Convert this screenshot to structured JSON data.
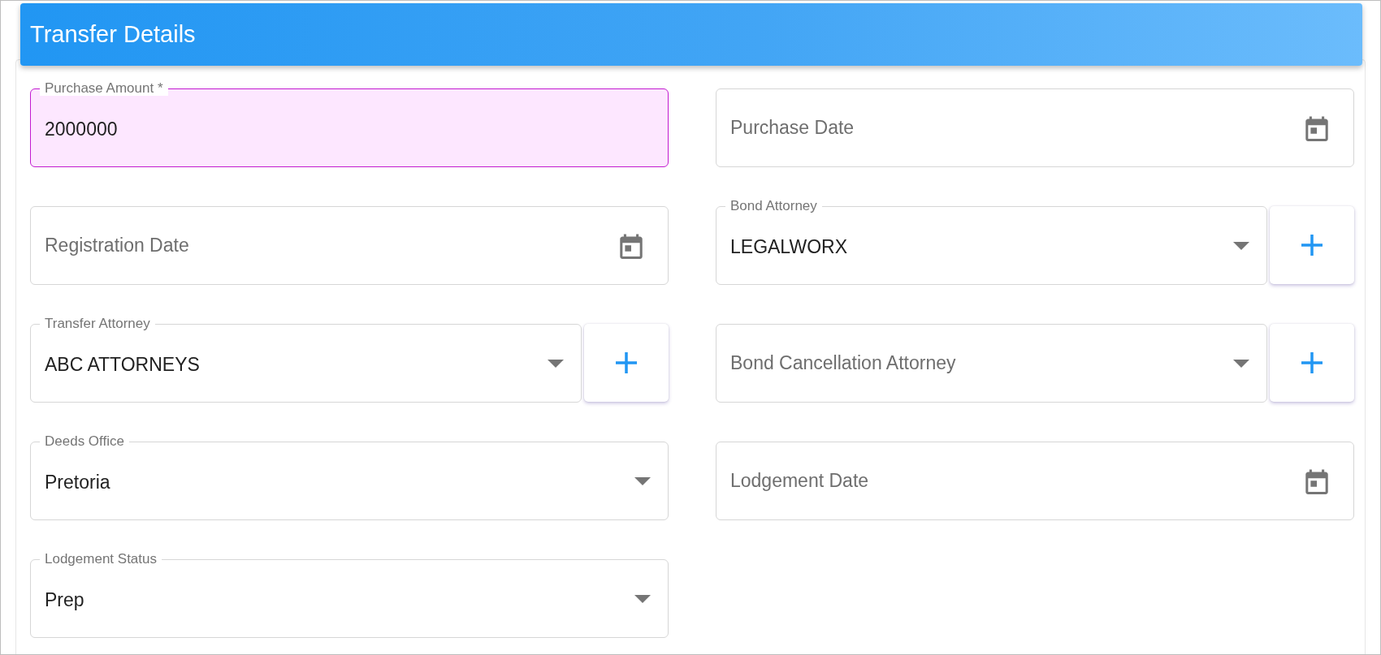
{
  "header": {
    "title": "Transfer Details"
  },
  "fields": [
    {
      "kind": "text",
      "label": "Purchase Amount *",
      "value": "2000000",
      "focused": true,
      "add_button": false
    },
    {
      "kind": "date",
      "label": "Purchase Date",
      "focused": false,
      "add_button": false
    },
    {
      "kind": "date",
      "label": "Registration Date",
      "focused": false,
      "add_button": false
    },
    {
      "kind": "select",
      "label": "Bond Attorney",
      "value": "LEGALWORX",
      "focused": false,
      "add_button": true
    },
    {
      "kind": "select",
      "label": "Transfer Attorney",
      "value": "ABC ATTORNEYS",
      "focused": false,
      "add_button": true
    },
    {
      "kind": "select",
      "label": "Bond Cancellation Attorney",
      "focused": false,
      "add_button": true
    },
    {
      "kind": "select",
      "label": "Deeds Office",
      "value": "Pretoria",
      "focused": false,
      "add_button": false
    },
    {
      "kind": "date",
      "label": "Lodgement Date",
      "focused": false,
      "add_button": false
    },
    {
      "kind": "select",
      "label": "Lodgement Status",
      "value": "Prep",
      "focused": false,
      "add_button": false
    }
  ]
}
